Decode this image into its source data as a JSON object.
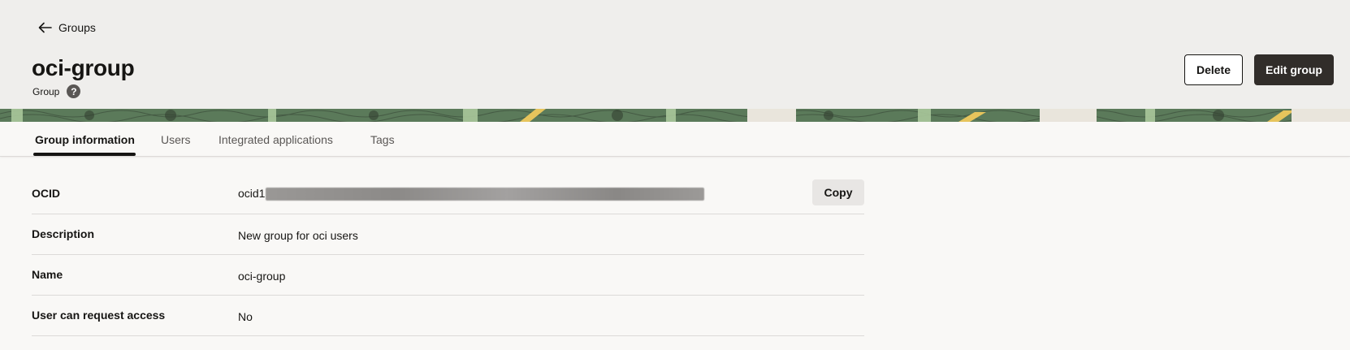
{
  "header": {
    "back_label": "Groups",
    "title": "oci-group",
    "subtitle": "Group",
    "help_glyph": "?",
    "delete_label": "Delete",
    "edit_label": "Edit group"
  },
  "tabs": [
    {
      "label": "Group information",
      "active": true
    },
    {
      "label": "Users",
      "active": false
    },
    {
      "label": "Integrated applications",
      "active": false
    },
    {
      "label": "Tags",
      "active": false
    }
  ],
  "details": {
    "ocid": {
      "label": "OCID",
      "value_prefix": "ocid1",
      "copy_label": "Copy"
    },
    "description": {
      "label": "Description",
      "value": "New group for oci users"
    },
    "name": {
      "label": "Name",
      "value": "oci-group"
    },
    "request_access": {
      "label": "User can request access",
      "value": "No"
    }
  },
  "colors": {
    "primary_button": "#312d2a",
    "band": "#5b7a5a",
    "header_bg": "#efeeec",
    "page_bg": "#f9f8f6"
  },
  "icons": {
    "back": "arrow-left-icon",
    "help": "help-icon"
  }
}
